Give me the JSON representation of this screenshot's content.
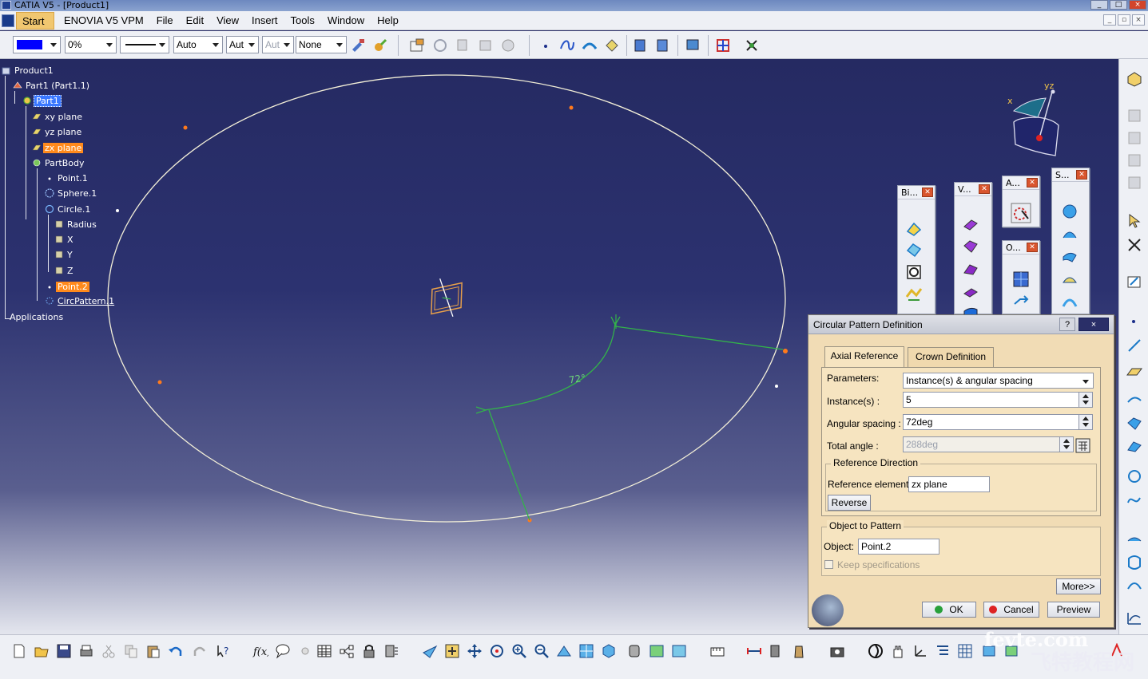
{
  "window": {
    "title": "CATIA V5 - [Product1]",
    "controls": [
      "_",
      "□",
      "×"
    ]
  },
  "menu": {
    "items": [
      "Start",
      "ENOVIA V5 VPM",
      "File",
      "Edit",
      "View",
      "Insert",
      "Tools",
      "Window",
      "Help"
    ],
    "mdi_controls": [
      "_",
      "▫",
      "×"
    ]
  },
  "style_toolbar": {
    "color_value": "#0000ff",
    "transparency": "0%",
    "thickness": "Auto",
    "linetype": "Aut",
    "point_style": "Aut",
    "layer": "None"
  },
  "tree": {
    "nodes": [
      {
        "label": "Product1",
        "icon": "product-icon",
        "state": "normal"
      },
      {
        "label": "Part1 (Part1.1)",
        "icon": "part-instance-icon",
        "state": "normal"
      },
      {
        "label": "Part1",
        "icon": "part-icon",
        "state": "current"
      },
      {
        "label": "xy plane",
        "icon": "plane-icon",
        "state": "normal"
      },
      {
        "label": "yz plane",
        "icon": "plane-icon",
        "state": "normal"
      },
      {
        "label": "zx plane",
        "icon": "plane-icon",
        "state": "selected"
      },
      {
        "label": "PartBody",
        "icon": "body-icon",
        "state": "normal"
      },
      {
        "label": "Point.1",
        "icon": "point-icon",
        "state": "normal"
      },
      {
        "label": "Sphere.1",
        "icon": "sphere-icon",
        "state": "normal"
      },
      {
        "label": "Circle.1",
        "icon": "circle-icon",
        "state": "normal"
      },
      {
        "label": "Radius",
        "icon": "parameter-icon",
        "state": "normal"
      },
      {
        "label": "X",
        "icon": "parameter-icon",
        "state": "normal"
      },
      {
        "label": "Y",
        "icon": "parameter-icon",
        "state": "normal"
      },
      {
        "label": "Z",
        "icon": "parameter-icon",
        "state": "normal"
      },
      {
        "label": "Point.2",
        "icon": "point-icon",
        "state": "selected"
      },
      {
        "label": "CircPattern.1",
        "icon": "pattern-icon",
        "state": "underlined"
      },
      {
        "label": "Applications",
        "icon": "",
        "state": "normal"
      }
    ]
  },
  "viewport": {
    "angle_label": "72°",
    "compass": {
      "x_label": "x",
      "yz_label": "yz"
    }
  },
  "floating_toolbars": [
    {
      "title": "Bi..."
    },
    {
      "title": "V..."
    },
    {
      "title": "A..."
    },
    {
      "title": "O..."
    },
    {
      "title": "S..."
    }
  ],
  "dialog": {
    "title": "Circular Pattern Definition",
    "help_label": "?",
    "close_label": "×",
    "tabs": [
      {
        "label": "Axial Reference",
        "active": true
      },
      {
        "label": "Crown Definition",
        "active": false
      }
    ],
    "parameters_label": "Parameters:",
    "parameters_value": "Instance(s) & angular spacing",
    "instances_label": "Instance(s) :",
    "instances_value": "5",
    "angular_spacing_label": "Angular spacing :",
    "angular_spacing_value": "72deg",
    "total_angle_label": "Total angle :",
    "total_angle_value": "288deg",
    "ref_direction_title": "Reference Direction",
    "ref_element_label": "Reference element:",
    "ref_element_value": "zx plane",
    "reverse_label": "Reverse",
    "object_group_title": "Object to Pattern",
    "object_label": "Object:",
    "object_value": "Point.2",
    "keep_spec_label": "Keep specifications",
    "keep_spec_checked": false,
    "more_label": "More>>",
    "ok_label": "OK",
    "cancel_label": "Cancel",
    "preview_label": "Preview"
  },
  "watermark": {
    "line1": "fevte.com",
    "line2": "飞特教程网"
  },
  "colors": {
    "background": "#2a2f68",
    "selection": "#ff8a1c",
    "circle": "#f4f0d8",
    "pattern_marker": "#2fa83a",
    "dialog_bg": "#f1dcb5"
  }
}
